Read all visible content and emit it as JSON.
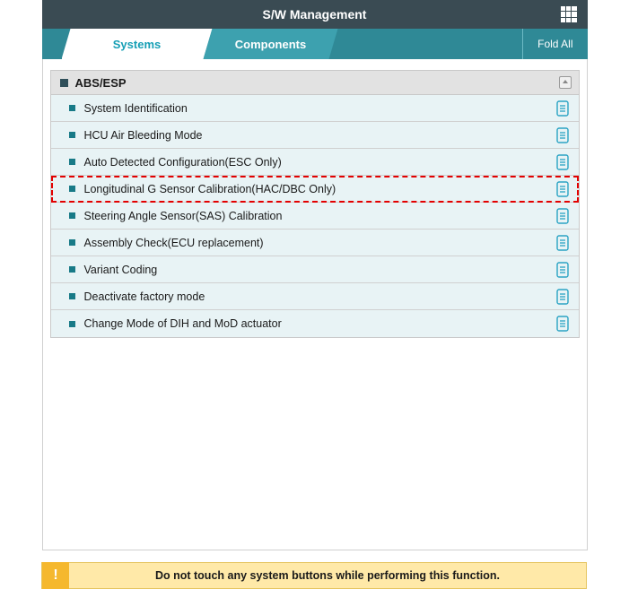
{
  "header": {
    "title": "S/W Management"
  },
  "tabs": {
    "systems": "Systems",
    "components": "Components",
    "fold_all": "Fold All"
  },
  "section": {
    "title": "ABS/ESP"
  },
  "items": [
    {
      "label": "System Identification",
      "highlighted": false
    },
    {
      "label": "HCU Air Bleeding Mode",
      "highlighted": false
    },
    {
      "label": "Auto Detected Configuration(ESC Only)",
      "highlighted": false
    },
    {
      "label": "Longitudinal G Sensor Calibration(HAC/DBC Only)",
      "highlighted": true
    },
    {
      "label": "Steering Angle Sensor(SAS) Calibration",
      "highlighted": false
    },
    {
      "label": "Assembly Check(ECU replacement)",
      "highlighted": false
    },
    {
      "label": "Variant Coding",
      "highlighted": false
    },
    {
      "label": "Deactivate factory mode",
      "highlighted": false
    },
    {
      "label": "Change Mode of DIH and MoD actuator",
      "highlighted": false
    }
  ],
  "warning": {
    "icon": "!",
    "text": "Do not touch any system buttons while performing this function."
  }
}
